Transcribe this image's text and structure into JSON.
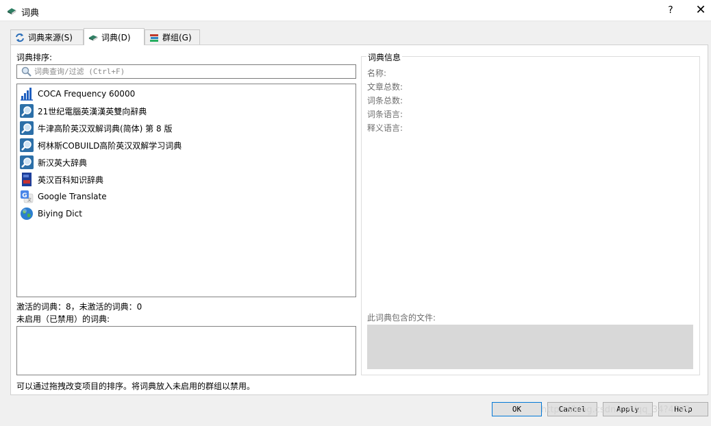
{
  "window": {
    "title": "词典",
    "help": "?",
    "close": "✕"
  },
  "tabs": [
    {
      "label": "词典来源(S)",
      "icon": "refresh-icon"
    },
    {
      "label": "词典(D)",
      "icon": "book-icon"
    },
    {
      "label": "群组(G)",
      "icon": "books-stack-icon"
    }
  ],
  "left": {
    "sort_label": "词典排序:",
    "search_placeholder": "词典查询/过滤 (Ctrl+F)",
    "items": [
      {
        "label": "COCA Frequency 60000",
        "icon": "bar-chart-icon"
      },
      {
        "label": "21世纪電腦英漢漢英雙向辭典",
        "icon": "magnifier-icon"
      },
      {
        "label": "牛津高阶英汉双解词典(简体) 第 8 版",
        "icon": "magnifier-icon"
      },
      {
        "label": "柯林斯COBUILD高阶英汉双解学习词典",
        "icon": "magnifier-icon"
      },
      {
        "label": "新汉英大辞典",
        "icon": "magnifier-icon"
      },
      {
        "label": "英汉百科知识辞典",
        "icon": "blue-book-icon"
      },
      {
        "label": "Google Translate",
        "icon": "google-translate-icon"
      },
      {
        "label": "Biying Dict",
        "icon": "globe-icon"
      }
    ],
    "active_count": "激活的词典：8，未激活的词典：0",
    "disabled_label": "未启用（已禁用）的词典:",
    "hint": "可以通过拖拽改变项目的排序。将词典放入未启用的群组以禁用。"
  },
  "info": {
    "title": "词典信息",
    "rows": [
      "名称:",
      "文章总数:",
      "词条总数:",
      "词条语言:",
      "释义语言:"
    ],
    "files_label": "此词典包含的文件:"
  },
  "buttons": {
    "ok": "OK",
    "cancel": "Cancel",
    "apply": "Apply",
    "help": "Help"
  },
  "watermark": "https://blog.csdn.net/qq_34?4?99",
  "colors": {
    "accent": "#0078d7",
    "files_box": "#d8d8d8"
  }
}
